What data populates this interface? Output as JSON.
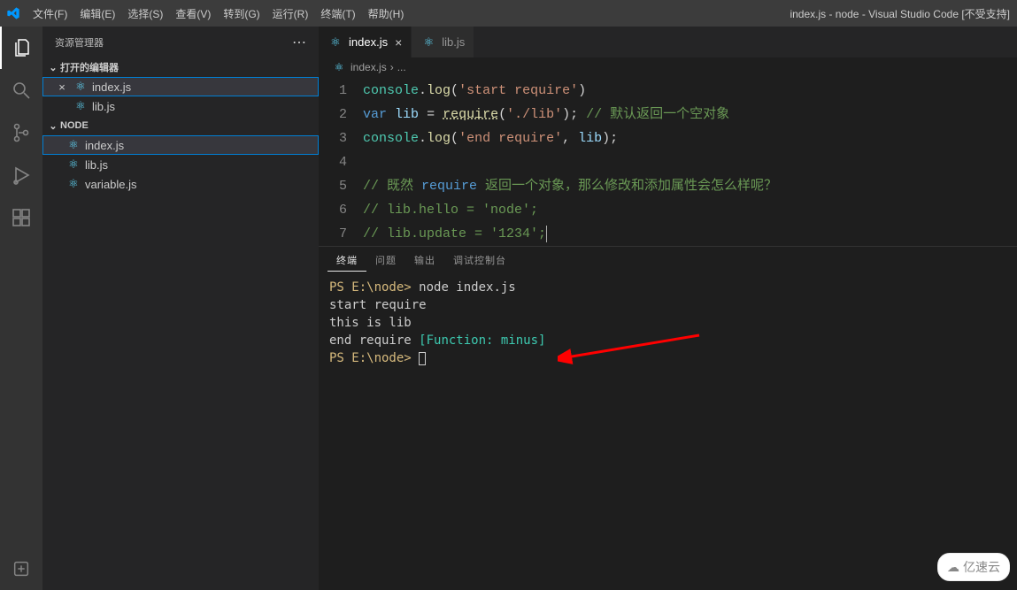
{
  "titlebar": {
    "menus": [
      "文件(F)",
      "编辑(E)",
      "选择(S)",
      "查看(V)",
      "转到(G)",
      "运行(R)",
      "终端(T)",
      "帮助(H)"
    ],
    "title": "index.js - node - Visual Studio Code [不受支持]"
  },
  "sidebar": {
    "title": "资源管理器",
    "openEditorsLabel": "打开的编辑器",
    "openEditors": [
      {
        "name": "index.js",
        "active": true,
        "close": "×"
      },
      {
        "name": "lib.js",
        "active": false,
        "close": ""
      }
    ],
    "folderLabel": "NODE",
    "files": [
      {
        "name": "index.js",
        "active": true
      },
      {
        "name": "lib.js",
        "active": false
      },
      {
        "name": "variable.js",
        "active": false
      }
    ]
  },
  "tabs": [
    {
      "name": "index.js",
      "active": true,
      "close": "×"
    },
    {
      "name": "lib.js",
      "active": false,
      "close": ""
    }
  ],
  "breadcrumb": {
    "file": "index.js",
    "rest": "..."
  },
  "code": {
    "lines": [
      {
        "n": 1,
        "html": "<span class='t-obj'>console</span><span class='t-pun'>.</span><span class='t-fn'>log</span><span class='t-pun'>(</span><span class='t-str'>'start require'</span><span class='t-pun'>)</span>"
      },
      {
        "n": 2,
        "html": "<span class='t-kw'>var</span> <span class='t-id'>lib</span> <span class='t-pun'>=</span> <span class='t-fn t-link'>require</span><span class='t-pun'>(</span><span class='t-str'>'./lib'</span><span class='t-pun'>);</span> <span class='t-comment'>// 默认返回一个空对象</span>"
      },
      {
        "n": 3,
        "html": "<span class='t-obj'>console</span><span class='t-pun'>.</span><span class='t-fn'>log</span><span class='t-pun'>(</span><span class='t-str'>'end require'</span><span class='t-pun'>,</span> <span class='t-id'>lib</span><span class='t-pun'>);</span>"
      },
      {
        "n": 4,
        "html": ""
      },
      {
        "n": 5,
        "html": "<span class='t-comment'>// 既然 <span style=\"color:#569cd6\">require</span> 返回一个对象，那么修改和添加属性会怎么样呢？</span>"
      },
      {
        "n": 6,
        "html": "<span class='t-comment'>// lib.hello = 'node';</span>"
      },
      {
        "n": 7,
        "html": "<span class='t-comment'>// lib.update = '1234';</span><span class='cursor'></span>"
      }
    ]
  },
  "panel": {
    "tabs": [
      "终端",
      "问题",
      "输出",
      "调试控制台"
    ],
    "activeTab": 0,
    "terminal": {
      "prompt1": "PS E:\\node>",
      "cmd": "node index.js",
      "line2": "start require",
      "line3": "this is lib",
      "line4a": "end require ",
      "line4b": "[Function: minus]",
      "prompt2": "PS E:\\node>"
    }
  },
  "watermark": "亿速云"
}
